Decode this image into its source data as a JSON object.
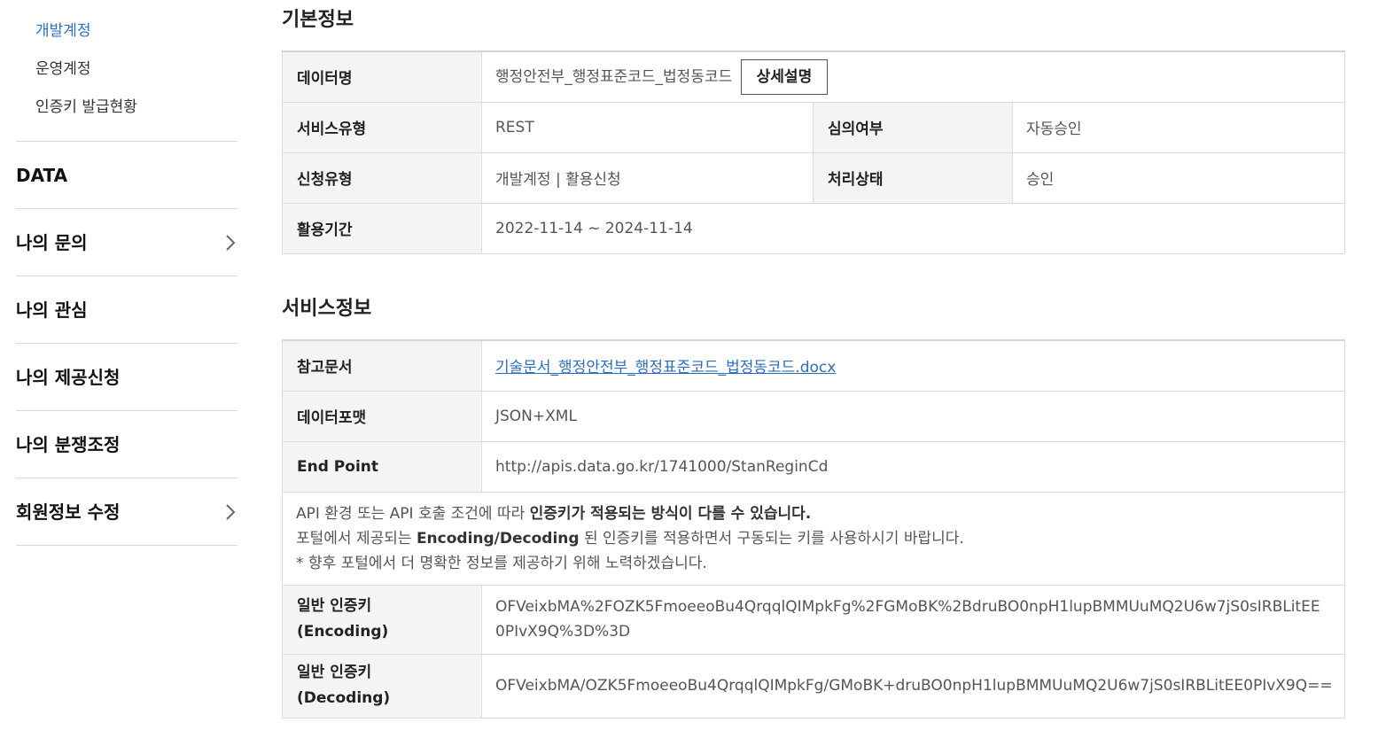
{
  "sidebar": {
    "sub_items": [
      "개발계정",
      "운영계정",
      "인증키 발급현황"
    ],
    "heads": [
      {
        "label": "DATA",
        "chevron": false
      },
      {
        "label": "나의 문의",
        "chevron": true
      },
      {
        "label": "나의 관심",
        "chevron": false
      },
      {
        "label": "나의 제공신청",
        "chevron": false
      },
      {
        "label": "나의 분쟁조정",
        "chevron": false
      },
      {
        "label": "회원정보 수정",
        "chevron": true
      }
    ]
  },
  "basic": {
    "title": "기본정보",
    "data_name_label": "데이터명",
    "data_name_value": "행정안전부_행정표준코드_법정동코드",
    "detail_button": "상세설명",
    "service_type_label": "서비스유형",
    "service_type_value": "REST",
    "review_label": "심의여부",
    "review_value": "자동승인",
    "apply_type_label": "신청유형",
    "apply_type_value": "개발계정 | 활용신청",
    "status_label": "처리상태",
    "status_value": "승인",
    "period_label": "활용기간",
    "period_value": "2022-11-14 ~ 2024-11-14"
  },
  "service": {
    "title": "서비스정보",
    "ref_doc_label": "참고문서",
    "ref_doc_value": "기술문서_행정안전부_행정표준코드_법정동코드.docx",
    "format_label": "데이터포맷",
    "format_value": "JSON+XML",
    "endpoint_label": "End Point",
    "endpoint_value": "http://apis.data.go.kr/1741000/StanReginCd",
    "notice_line1_a": "API 환경 또는 API 호출 조건에 따라 ",
    "notice_line1_b": "인증키가 적용되는 방식이 다를 수 있습니다.",
    "notice_line2_a": "포털에서 제공되는 ",
    "notice_line2_b": "Encoding/Decoding",
    "notice_line2_c": " 된 인증키를 적용하면서 구동되는 키를 사용하시기 바랍니다.",
    "notice_line3": "* 향후 포털에서 더 명확한 정보를 제공하기 위해 노력하겠습니다.",
    "enc_label_1": "일반 인증키",
    "enc_label_2": "(Encoding)",
    "enc_value": "OFVeixbMA%2FOZK5FmoeeoBu4QrqqlQIMpkFg%2FGMoBK%2BdruBO0npH1lupBMMUuMQ2U6w7jS0sIRBLitEE0PIvX9Q%3D%3D",
    "dec_label_1": "일반 인증키",
    "dec_label_2": "(Decoding)",
    "dec_value": "OFVeixbMA/OZK5FmoeeoBu4QrqqlQIMpkFg/GMoBK+druBO0npH1lupBMMUuMQ2U6w7jS0sIRBLitEE0PIvX9Q=="
  }
}
